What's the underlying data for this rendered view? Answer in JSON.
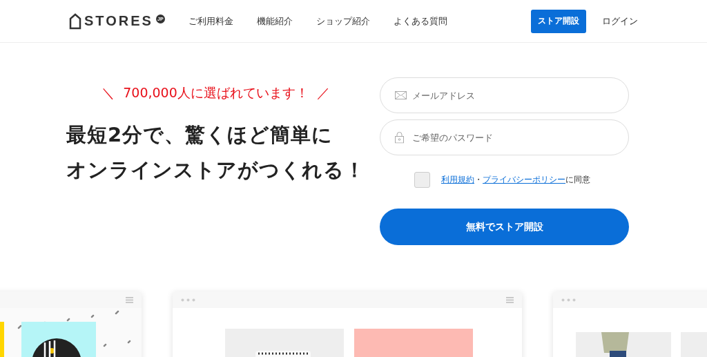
{
  "header": {
    "logo": "STORES",
    "logo_badge": "JP",
    "nav": [
      "ご利用料金",
      "機能紹介",
      "ショップ紹介",
      "よくある質問"
    ],
    "cta": "ストア開設",
    "login": "ログイン"
  },
  "hero": {
    "tagline_open": "＼",
    "tagline": "700,000人に選ばれています！",
    "tagline_close": "／",
    "headline": [
      "最短2分で、驚くほど簡単に",
      "オンラインストアがつくれる！"
    ]
  },
  "form": {
    "email": {
      "placeholder": "メールアドレス"
    },
    "password": {
      "placeholder": "ご希望のパスワード"
    },
    "agreement": {
      "checked": false,
      "terms_link": "利用規約",
      "separator": "・",
      "privacy_link": "プライバシーポリシー",
      "suffix": "に同意"
    },
    "submit": "無料でストア開設"
  }
}
